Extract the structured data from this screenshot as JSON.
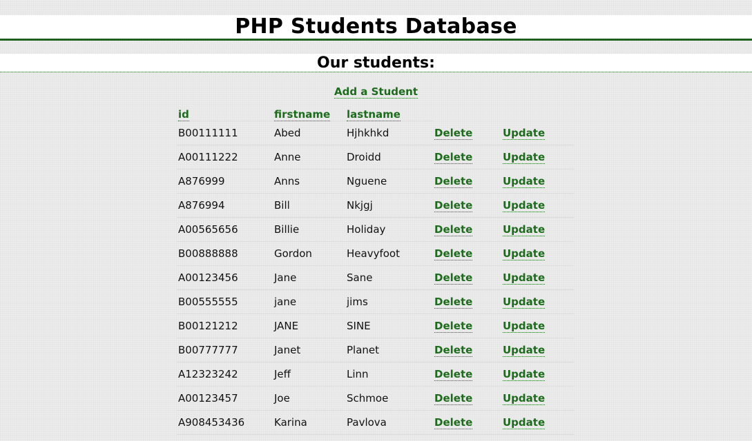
{
  "header": {
    "title": "PHP Students Database"
  },
  "section": {
    "title": "Our students:"
  },
  "actions": {
    "add_label": "Add a Student"
  },
  "table": {
    "columns": [
      "id",
      "firstname",
      "lastname"
    ],
    "delete_label": "Delete",
    "update_label": "Update",
    "rows": [
      {
        "id": "B00111111",
        "firstname": "Abed",
        "lastname": "Hjhkhkd"
      },
      {
        "id": "A00111222",
        "firstname": "Anne",
        "lastname": "Droidd"
      },
      {
        "id": "A876999",
        "firstname": "Anns",
        "lastname": "Nguene"
      },
      {
        "id": "A876994",
        "firstname": "Bill",
        "lastname": "Nkjgj"
      },
      {
        "id": "A00565656",
        "firstname": "Billie",
        "lastname": "Holiday"
      },
      {
        "id": "B00888888",
        "firstname": "Gordon",
        "lastname": "Heavyfoot"
      },
      {
        "id": "A00123456",
        "firstname": "Jane",
        "lastname": "Sane"
      },
      {
        "id": "B00555555",
        "firstname": "jane",
        "lastname": "jims"
      },
      {
        "id": "B00121212",
        "firstname": "JANE",
        "lastname": "SINE"
      },
      {
        "id": "B00777777",
        "firstname": "Janet",
        "lastname": "Planet"
      },
      {
        "id": "A12323242",
        "firstname": "Jeff",
        "lastname": "Linn"
      },
      {
        "id": "A00123457",
        "firstname": "Joe",
        "lastname": "Schmoe"
      },
      {
        "id": "A908453436",
        "firstname": "Karina",
        "lastname": "Pavlova"
      }
    ]
  },
  "colors": {
    "link": "#1e6b1e",
    "header_rule": "#1f5f1f",
    "background": "#e9e9e9"
  }
}
